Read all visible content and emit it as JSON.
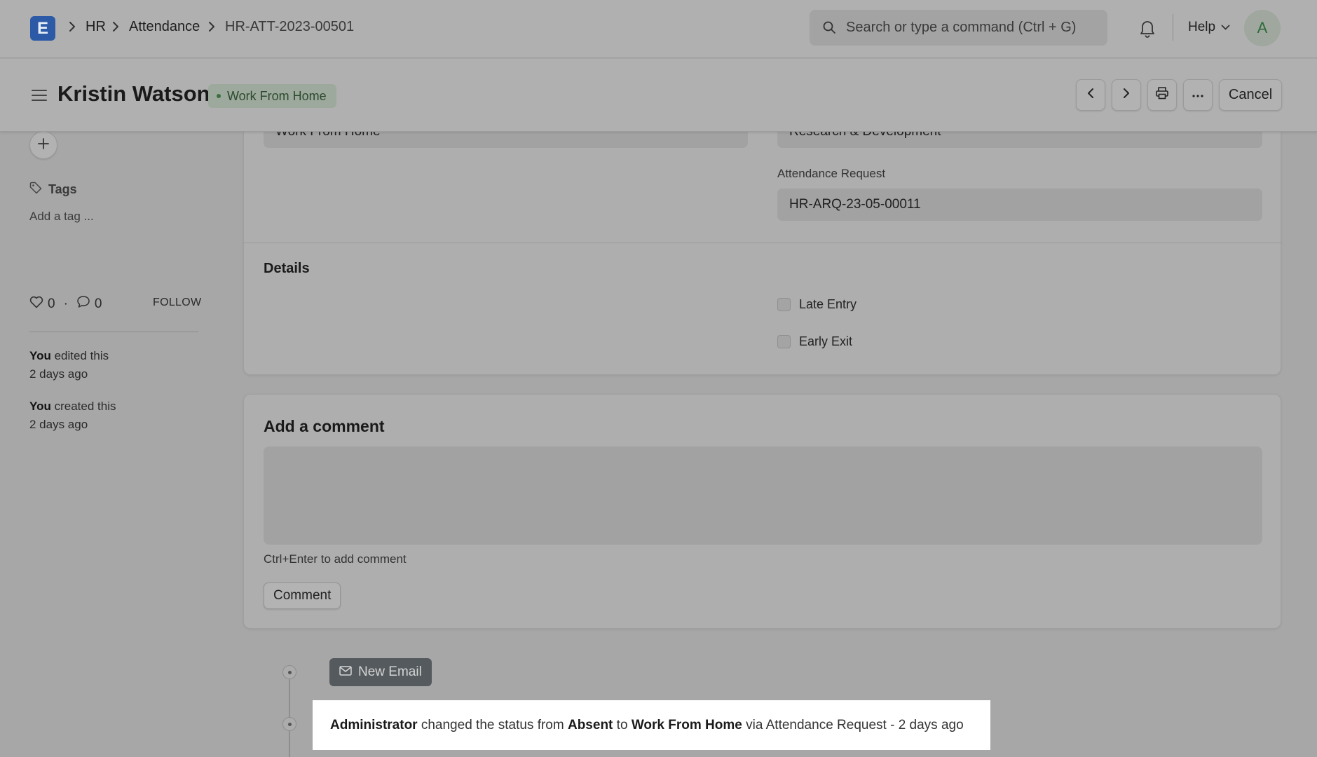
{
  "navbar": {
    "logo_letter": "E",
    "breadcrumbs": [
      "HR",
      "Attendance",
      "HR-ATT-2023-00501"
    ],
    "search_placeholder": "Search or type a command (Ctrl + G)",
    "help_label": "Help",
    "avatar_initial": "A"
  },
  "header": {
    "title": "Kristin Watson",
    "status": "Work From Home",
    "cancel_label": "Cancel"
  },
  "sidebar": {
    "tags_label": "Tags",
    "add_tag_placeholder": "Add a tag ...",
    "likes_count": "0",
    "comments_count": "0",
    "follow_label": "FOLLOW",
    "activity": [
      {
        "who": "You",
        "action": "edited this",
        "when": "2 days ago"
      },
      {
        "who": "You",
        "action": "created this",
        "when": "2 days ago"
      }
    ]
  },
  "form": {
    "status_value_partial": "Work From Home",
    "department_value_partial": "Research & Development",
    "attendance_request_label": "Attendance Request",
    "attendance_request_value": "HR-ARQ-23-05-00011",
    "details_title": "Details",
    "late_entry_label": "Late Entry",
    "early_exit_label": "Early Exit"
  },
  "comment": {
    "title": "Add a comment",
    "hint": "Ctrl+Enter to add comment",
    "button_label": "Comment"
  },
  "timeline": {
    "new_email_label": "New Email",
    "entry": {
      "actor": "Administrator",
      "text1": "changed the status from",
      "from": "Absent",
      "text2": "to",
      "to": "Work From Home",
      "text3": "via Attendance Request - 2 days ago"
    }
  },
  "colors": {
    "logo_bg": "#2c5aa6",
    "status_green": "#3b6e41",
    "new_email_bg": "#555a5e"
  }
}
